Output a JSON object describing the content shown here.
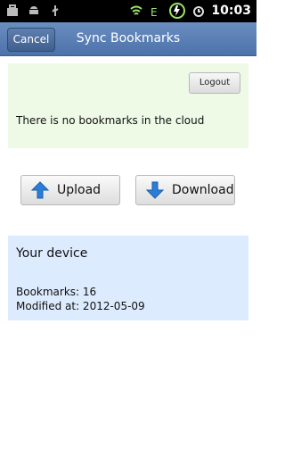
{
  "status_bar": {
    "time": "10:03",
    "left_icons": [
      "briefcase-icon",
      "android-icon",
      "usb-icon"
    ],
    "right_icons": [
      "wifi-icon",
      "signal-e-icon",
      "battery-charging-icon",
      "alarm-icon"
    ]
  },
  "header": {
    "cancel_label": "Cancel",
    "title": "Sync Bookmarks"
  },
  "cloud": {
    "logout_label": "Logout",
    "message": "There is no bookmarks in the cloud"
  },
  "actions": {
    "upload_label": "Upload",
    "download_label": "Download"
  },
  "device": {
    "title": "Your device",
    "bookmarks_line": "Bookmarks: 16",
    "modified_line": "Modified at: 2012-05-09"
  },
  "colors": {
    "title_bar": "#5f82b6",
    "cloud_panel_bg": "#eef9e6",
    "device_panel_bg": "#ddebfe",
    "arrow_blue": "#2b7ed8"
  }
}
